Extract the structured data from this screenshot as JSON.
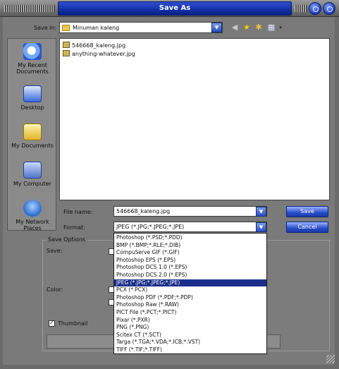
{
  "window": {
    "title": "Save As"
  },
  "save_in": {
    "label": "Save in:",
    "folder": "Minuman kaleng"
  },
  "places": [
    {
      "label": "My Recent Documents",
      "icon": "recent-documents-icon"
    },
    {
      "label": "Desktop",
      "icon": "desktop-icon"
    },
    {
      "label": "My Documents",
      "icon": "my-documents-icon"
    },
    {
      "label": "My Computer",
      "icon": "my-computer-icon"
    },
    {
      "label": "My Network Places",
      "icon": "network-places-icon"
    }
  ],
  "files": [
    {
      "name": "546668_kaleng.jpg"
    },
    {
      "name": "anything-whatever.jpg"
    }
  ],
  "file_name": {
    "label": "File name:",
    "value": "546668_kaleng.jpg"
  },
  "format": {
    "label": "Format:",
    "value": "JPEG (*.JPG;*.JPEG;*.JPE)"
  },
  "buttons": {
    "save": "Save",
    "cancel": "Cancel"
  },
  "save_options": {
    "title": "Save Options",
    "save_label": "Save:",
    "color_label": "Color:",
    "thumbnail_label": "Thumbnail",
    "thumbnail_checked": true
  },
  "format_options": [
    "Photoshop (*.PSD;*.PDD)",
    "BMP (*.BMP;*.RLE;*.DIB)",
    "CompuServe GIF (*.GIF)",
    "Photoshop EPS (*.EPS)",
    "Photoshop DCS 1.0 (*.EPS)",
    "Photoshop DCS 2.0 (*.EPS)",
    "JPEG (*.JPG;*.JPEG;*.JPE)",
    "PCX (*.PCX)",
    "Photoshop PDF (*.PDF;*.PDP)",
    "Photoshop Raw (*.RAW)",
    "PICT File (*.PCT;*.PICT)",
    "Pixar (*.PXR)",
    "PNG (*.PNG)",
    "Scitex CT (*.SCT)",
    "Targa (*.TGA;*.VDA;*.ICB;*.VST)",
    "TIFF (*.TIF;*.TIFF)"
  ],
  "format_selected_index": 6,
  "colors": {
    "title_bar": "#1230a6",
    "selection": "#1c2f8a",
    "button": "#2a4ec8",
    "dialog_bg": "#7a7a7a"
  }
}
